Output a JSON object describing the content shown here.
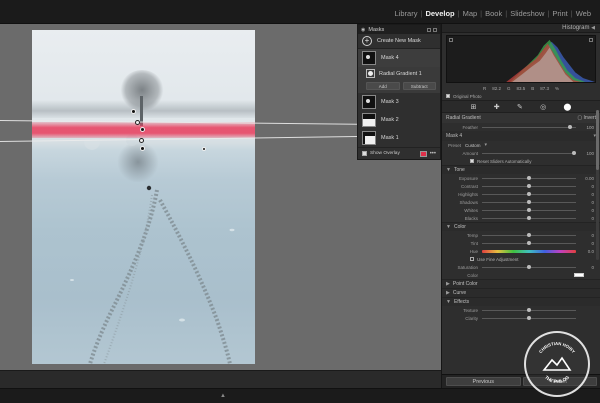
{
  "top_nav": {
    "modules": [
      "Library",
      "Develop",
      "Map",
      "Book",
      "Slideshow",
      "Print",
      "Web"
    ],
    "active": "Develop"
  },
  "masks_panel": {
    "title": "Masks",
    "create_label": "Create New Mask",
    "masks": [
      {
        "name": "Mask 4",
        "selected": true
      },
      {
        "name": "Mask 3"
      },
      {
        "name": "Mask 2"
      },
      {
        "name": "Mask 1"
      }
    ],
    "sub_item": "Radial Gradient 1",
    "add_label": "Add",
    "subtract_label": "Subtract",
    "show_overlay_label": "Show Overlay",
    "overlay_color": "#e0304a"
  },
  "right_panel": {
    "histogram_title": "Histogram",
    "readout": [
      "R",
      "82.2",
      "G",
      "83.5",
      "B",
      "87.3",
      "%"
    ],
    "original_photo_label": "Original Photo",
    "mask_header": "Radial Gradient",
    "invert_label": "Invert",
    "feather": {
      "label": "Feather",
      "value": "100",
      "level": 0.95
    },
    "mask_name": "Mask 4",
    "preset_label": "Preset",
    "preset_value": "Custom",
    "amount_label": "Amount",
    "amount_value": "100",
    "reset_sliders_label": "Reset Sliders Automatically",
    "tone_title": "Tone",
    "tone": [
      {
        "label": "Exposure",
        "value": "0.00",
        "level": 0.5
      },
      {
        "label": "Contrast",
        "value": "0",
        "level": 0.5
      },
      {
        "label": "Highlights",
        "value": "0",
        "level": 0.5
      },
      {
        "label": "Shadows",
        "value": "0",
        "level": 0.5
      },
      {
        "label": "Whites",
        "value": "0",
        "level": 0.5
      },
      {
        "label": "Blacks",
        "value": "0",
        "level": 0.5
      }
    ],
    "color_title": "Color",
    "color": [
      {
        "label": "Temp",
        "value": "0",
        "level": 0.5
      },
      {
        "label": "Tint",
        "value": "0",
        "level": 0.5
      }
    ],
    "hue_label": "Hue",
    "hue_value": "0.0",
    "fine_adjust_label": "Use Fine Adjustment",
    "saturation_label": "Saturation",
    "saturation_value": "0",
    "color_swatch_label": "Color",
    "point_color_title": "Point Color",
    "curve_title": "Curve",
    "effects_title": "Effects",
    "texture_label": "Texture",
    "clarity_label": "Clarity",
    "previous_label": "Previous",
    "reset_label": "Reset"
  },
  "watermark": {
    "text_top": "CHRISTIAN HOIBY",
    "text_bottom": "THE PHILOG"
  }
}
